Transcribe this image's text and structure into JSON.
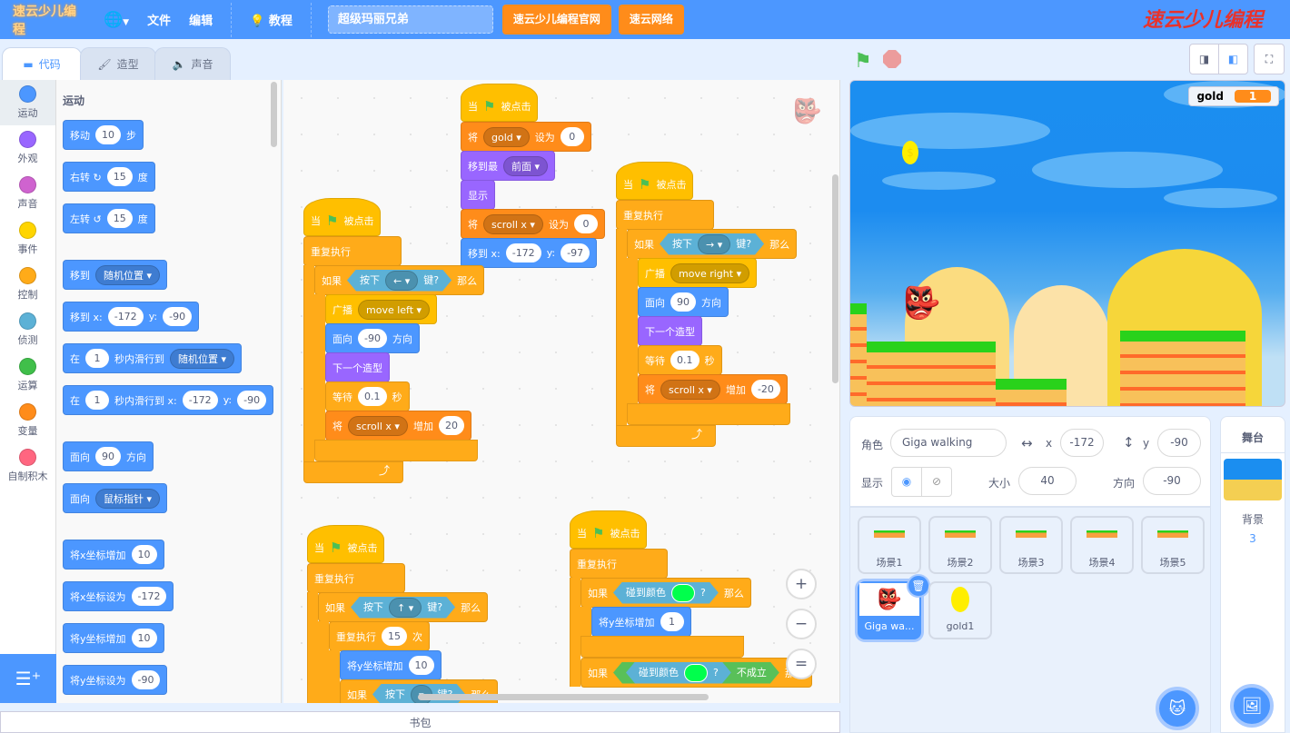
{
  "topbar": {
    "logo": "速云少儿编程",
    "globe_icon": "globe-icon",
    "file": "文件",
    "edit": "编辑",
    "tutorial": "教程",
    "project_title": "超级玛丽兄弟",
    "btn_official": "速云少儿编程官网",
    "btn_network": "速云网络",
    "brand": "速云少儿编程"
  },
  "tabs": [
    {
      "label": "代码",
      "icon": "code-icon"
    },
    {
      "label": "造型",
      "icon": "brush-icon"
    },
    {
      "label": "声音",
      "icon": "speaker-icon"
    }
  ],
  "categories": [
    {
      "label": "运动",
      "color": "#4c97ff"
    },
    {
      "label": "外观",
      "color": "#9966ff"
    },
    {
      "label": "声音",
      "color": "#cf63cf"
    },
    {
      "label": "事件",
      "color": "#ffd500"
    },
    {
      "label": "控制",
      "color": "#ffab19"
    },
    {
      "label": "侦测",
      "color": "#5cb1d6"
    },
    {
      "label": "运算",
      "color": "#40bf4a"
    },
    {
      "label": "变量",
      "color": "#ff8c1a"
    },
    {
      "label": "自制积木",
      "color": "#ff6680"
    }
  ],
  "palette": {
    "title": "运动",
    "blocks": [
      [
        [
          "移动"
        ],
        {
          "i": "10"
        },
        [
          "步"
        ]
      ],
      [
        [
          "右转 ↻"
        ],
        {
          "i": "15"
        },
        [
          "度"
        ]
      ],
      [
        [
          "左转 ↺"
        ],
        {
          "i": "15"
        },
        [
          "度"
        ]
      ],
      [
        [
          "移到"
        ],
        {
          "d": "随机位置"
        }
      ],
      [
        [
          "移到 x:"
        ],
        {
          "i": "-172"
        },
        [
          "y:"
        ],
        {
          "i": "-90"
        }
      ],
      [
        [
          "在"
        ],
        {
          "i": "1"
        },
        [
          "秒内滑行到"
        ],
        {
          "d": "随机位置"
        }
      ],
      [
        [
          "在"
        ],
        {
          "i": "1"
        },
        [
          "秒内滑行到 x:"
        ],
        {
          "i": "-172"
        },
        [
          "y:"
        ],
        {
          "i": "-90"
        }
      ],
      [
        [
          "面向"
        ],
        {
          "i": "90"
        },
        [
          "方向"
        ]
      ],
      [
        [
          "面向"
        ],
        {
          "d": "鼠标指针"
        }
      ],
      [
        [
          "将x坐标增加"
        ],
        {
          "i": "10"
        }
      ],
      [
        [
          "将x坐标设为"
        ],
        {
          "i": "-172"
        }
      ],
      [
        [
          "将y坐标增加"
        ],
        {
          "i": "10"
        }
      ],
      [
        [
          "将y坐标设为"
        ],
        {
          "i": "-90"
        }
      ]
    ]
  },
  "scripts": [
    [
      {
        "k": "hat",
        "c": "events",
        "p": [
          [
            "当"
          ],
          {
            "f": 1
          },
          [
            "被点击"
          ]
        ]
      },
      {
        "k": "c",
        "c": "control",
        "d": 0,
        "p": [
          [
            "重复执行"
          ]
        ]
      },
      {
        "k": "c",
        "c": "control",
        "d": 1,
        "p": [
          [
            "如果"
          ],
          {
            "b": [
              [
                "按下"
              ],
              {
                "d": "←",
                "c": "sensing"
              },
              [
                "键?"
              ]
            ],
            "c": "sensing"
          },
          [
            "那么"
          ]
        ]
      },
      {
        "k": "s",
        "c": "events",
        "d": 2,
        "p": [
          [
            "广播"
          ],
          {
            "d": "move left",
            "c": "events"
          }
        ]
      },
      {
        "k": "s",
        "c": "motion",
        "d": 2,
        "p": [
          [
            "面向"
          ],
          {
            "i": "-90"
          },
          [
            "方向"
          ]
        ]
      },
      {
        "k": "s",
        "c": "looks",
        "d": 2,
        "p": [
          [
            "下一个造型"
          ]
        ]
      },
      {
        "k": "s",
        "c": "control",
        "d": 2,
        "p": [
          [
            "等待"
          ],
          {
            "i": "0.1"
          },
          [
            "秒"
          ]
        ]
      },
      {
        "k": "s",
        "c": "variables",
        "d": 2,
        "p": [
          [
            "将"
          ],
          {
            "d": "scroll x",
            "c": "variables"
          },
          [
            "增加"
          ],
          {
            "i": "20"
          }
        ]
      },
      {
        "k": "end",
        "d": 1
      },
      {
        "k": "end",
        "d": 0,
        "loop": 1
      }
    ],
    [
      {
        "k": "hat",
        "c": "events",
        "p": [
          [
            "当"
          ],
          {
            "f": 1
          },
          [
            "被点击"
          ]
        ]
      },
      {
        "k": "s",
        "c": "variables",
        "d": 0,
        "p": [
          [
            "将"
          ],
          {
            "d": "gold",
            "c": "variables"
          },
          [
            "设为"
          ],
          {
            "i": "0"
          }
        ]
      },
      {
        "k": "s",
        "c": "looks",
        "d": 0,
        "p": [
          [
            "移到最"
          ],
          {
            "d": "前面",
            "c": "looks"
          }
        ]
      },
      {
        "k": "s",
        "c": "looks",
        "d": 0,
        "p": [
          [
            "显示"
          ]
        ]
      },
      {
        "k": "s",
        "c": "variables",
        "d": 0,
        "p": [
          [
            "将"
          ],
          {
            "d": "scroll x",
            "c": "variables"
          },
          [
            "设为"
          ],
          {
            "i": "0"
          }
        ]
      },
      {
        "k": "s",
        "c": "motion",
        "d": 0,
        "p": [
          [
            "移到 x:"
          ],
          {
            "i": "-172"
          },
          [
            "y:"
          ],
          {
            "i": "-97"
          }
        ]
      }
    ],
    [
      {
        "k": "hat",
        "c": "events",
        "p": [
          [
            "当"
          ],
          {
            "f": 1
          },
          [
            "被点击"
          ]
        ]
      },
      {
        "k": "c",
        "c": "control",
        "d": 0,
        "p": [
          [
            "重复执行"
          ]
        ]
      },
      {
        "k": "c",
        "c": "control",
        "d": 1,
        "p": [
          [
            "如果"
          ],
          {
            "b": [
              [
                "按下"
              ],
              {
                "d": "→",
                "c": "sensing"
              },
              [
                "键?"
              ]
            ],
            "c": "sensing"
          },
          [
            "那么"
          ]
        ]
      },
      {
        "k": "s",
        "c": "events",
        "d": 2,
        "p": [
          [
            "广播"
          ],
          {
            "d": "move right",
            "c": "events"
          }
        ]
      },
      {
        "k": "s",
        "c": "motion",
        "d": 2,
        "p": [
          [
            "面向"
          ],
          {
            "i": "90"
          },
          [
            "方向"
          ]
        ]
      },
      {
        "k": "s",
        "c": "looks",
        "d": 2,
        "p": [
          [
            "下一个造型"
          ]
        ]
      },
      {
        "k": "s",
        "c": "control",
        "d": 2,
        "p": [
          [
            "等待"
          ],
          {
            "i": "0.1"
          },
          [
            "秒"
          ]
        ]
      },
      {
        "k": "s",
        "c": "variables",
        "d": 2,
        "p": [
          [
            "将"
          ],
          {
            "d": "scroll x",
            "c": "variables"
          },
          [
            "增加"
          ],
          {
            "i": "-20"
          }
        ]
      },
      {
        "k": "end",
        "d": 1
      },
      {
        "k": "end",
        "d": 0,
        "loop": 1
      }
    ],
    [
      {
        "k": "hat",
        "c": "events",
        "p": [
          [
            "当"
          ],
          {
            "f": 1
          },
          [
            "被点击"
          ]
        ]
      },
      {
        "k": "c",
        "c": "control",
        "d": 0,
        "p": [
          [
            "重复执行"
          ]
        ]
      },
      {
        "k": "c",
        "c": "control",
        "d": 1,
        "p": [
          [
            "如果"
          ],
          {
            "b": [
              [
                "按下"
              ],
              {
                "d": "↑",
                "c": "sensing"
              },
              [
                "键?"
              ]
            ],
            "c": "sensing"
          },
          [
            "那么"
          ]
        ]
      },
      {
        "k": "c",
        "c": "control",
        "d": 2,
        "p": [
          [
            "重复执行"
          ],
          {
            "i": "15"
          },
          [
            "次"
          ]
        ]
      },
      {
        "k": "s",
        "c": "motion",
        "d": 3,
        "p": [
          [
            "将y坐标增加"
          ],
          {
            "i": "10"
          }
        ]
      },
      {
        "k": "c",
        "c": "control",
        "d": 3,
        "p": [
          [
            "如果"
          ],
          {
            "b": [
              [
                "按下"
              ],
              {
                "d": " ",
                "c": "sensing"
              },
              [
                "键?"
              ]
            ],
            "c": "sensing"
          },
          [
            "那么"
          ]
        ]
      }
    ],
    [
      {
        "k": "hat",
        "c": "events",
        "p": [
          [
            "当"
          ],
          {
            "f": 1
          },
          [
            "被点击"
          ]
        ]
      },
      {
        "k": "c",
        "c": "control",
        "d": 0,
        "p": [
          [
            "重复执行"
          ]
        ]
      },
      {
        "k": "c",
        "c": "control",
        "d": 1,
        "p": [
          [
            "如果"
          ],
          {
            "b": [
              [
                "碰到颜色"
              ],
              {
                "sw": "#00ff4c"
              },
              [
                "?"
              ]
            ],
            "c": "sensing"
          },
          [
            "那么"
          ]
        ]
      },
      {
        "k": "s",
        "c": "motion",
        "d": 2,
        "p": [
          [
            "将y坐标增加"
          ],
          {
            "i": "1"
          }
        ]
      },
      {
        "k": "end",
        "d": 1
      },
      {
        "k": "c",
        "c": "control",
        "d": 1,
        "p": [
          [
            "如果"
          ],
          {
            "b": [
              {
                "b": [
                  [
                    "碰到颜色"
                  ],
                  {
                    "sw": "#00ff4c"
                  },
                  [
                    "?"
                  ]
                ],
                "c": "sensing"
              },
              [
                "不成立"
              ]
            ],
            "c": "operators"
          },
          [
            "那么"
          ]
        ]
      }
    ]
  ],
  "block_colors": {
    "motion": "#4c97ff",
    "looks": "#9966ff",
    "events": "#ffbf00",
    "control": "#ffab19",
    "sensing": "#5cb1d6",
    "operators": "#59c059",
    "variables": "#ff8c1a"
  },
  "workspace": {
    "zoom_in": "+",
    "zoom_out": "−",
    "reset": "="
  },
  "backpack": "书包",
  "stage": {
    "monitor_name": "gold",
    "monitor_value": "1"
  },
  "sprite_info": {
    "sprite_label": "角色",
    "sprite_name": "Giga walking",
    "x_label": "x",
    "x": "-172",
    "y_label": "y",
    "y": "-90",
    "show_label": "显示",
    "size_label": "大小",
    "size": "40",
    "direction_label": "方向",
    "direction": "-90"
  },
  "sprites": [
    {
      "name": "场景1"
    },
    {
      "name": "场景2"
    },
    {
      "name": "场景3"
    },
    {
      "name": "场景4"
    },
    {
      "name": "场景5"
    },
    {
      "name": "Giga wa...",
      "selected": true
    },
    {
      "name": "gold1"
    }
  ],
  "stage_pane": {
    "title": "舞台",
    "backdrop_label": "背景",
    "backdrop_count": "3"
  }
}
